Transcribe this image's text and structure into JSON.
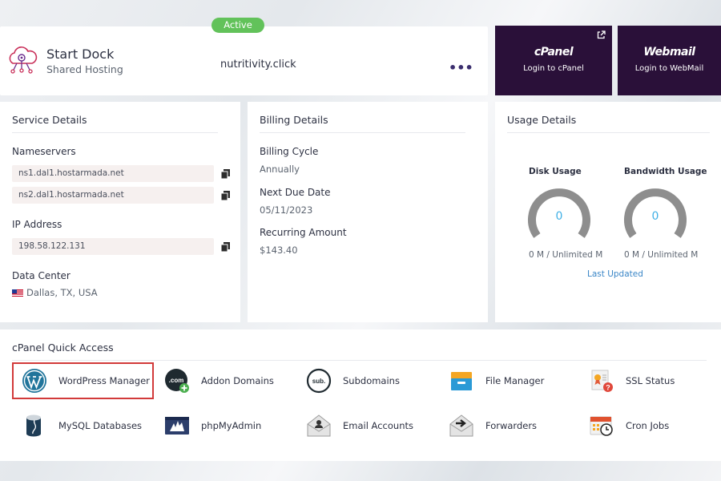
{
  "service": {
    "status": "Active",
    "plan_name": "Start Dock",
    "plan_type": "Shared Hosting",
    "domain": "nutritivity.click",
    "more_label": "•••"
  },
  "quick_buttons": {
    "cpanel": {
      "title": "cPanel",
      "subtitle": "Login to cPanel"
    },
    "webmail": {
      "title": "Webmail",
      "subtitle": "Login to WebMail"
    }
  },
  "service_details": {
    "title": "Service Details",
    "nameservers_label": "Nameservers",
    "nameservers": [
      "ns1.dal1.hostarmada.net",
      "ns2.dal1.hostarmada.net"
    ],
    "ip_label": "IP Address",
    "ip": "198.58.122.131",
    "datacenter_label": "Data Center",
    "datacenter": "Dallas, TX, USA"
  },
  "billing_details": {
    "title": "Billing Details",
    "cycle_label": "Billing Cycle",
    "cycle": "Annually",
    "due_label": "Next Due Date",
    "due": "05/11/2023",
    "amount_label": "Recurring Amount",
    "amount": "$143.40"
  },
  "usage_details": {
    "title": "Usage Details",
    "disk": {
      "label": "Disk Usage",
      "value": "0",
      "caption": "0 M / Unlimited M",
      "fraction": 0
    },
    "bandwidth": {
      "label": "Bandwidth Usage",
      "value": "0",
      "caption": "0 M / Unlimited M",
      "fraction": 0
    },
    "last_updated": "Last Updated"
  },
  "quick_access": {
    "title": "cPanel Quick Access",
    "items": [
      {
        "label": "WordPress Manager",
        "icon": "wordpress-icon"
      },
      {
        "label": "Addon Domains",
        "icon": "dotcom-icon"
      },
      {
        "label": "Subdomains",
        "icon": "sub-icon"
      },
      {
        "label": "File Manager",
        "icon": "file-manager-icon"
      },
      {
        "label": "SSL Status",
        "icon": "ssl-certificate-icon"
      },
      {
        "label": "MySQL Databases",
        "icon": "database-icon"
      },
      {
        "label": "phpMyAdmin",
        "icon": "phpmyadmin-icon"
      },
      {
        "label": "Email Accounts",
        "icon": "email-icon"
      },
      {
        "label": "Forwarders",
        "icon": "forwarder-icon"
      },
      {
        "label": "Cron Jobs",
        "icon": "calendar-clock-icon"
      }
    ]
  },
  "colors": {
    "accent_dark": "#2a1039",
    "active_green": "#62c25a",
    "gauge_value": "#40b0e6",
    "highlight_red": "#d23a3a"
  }
}
